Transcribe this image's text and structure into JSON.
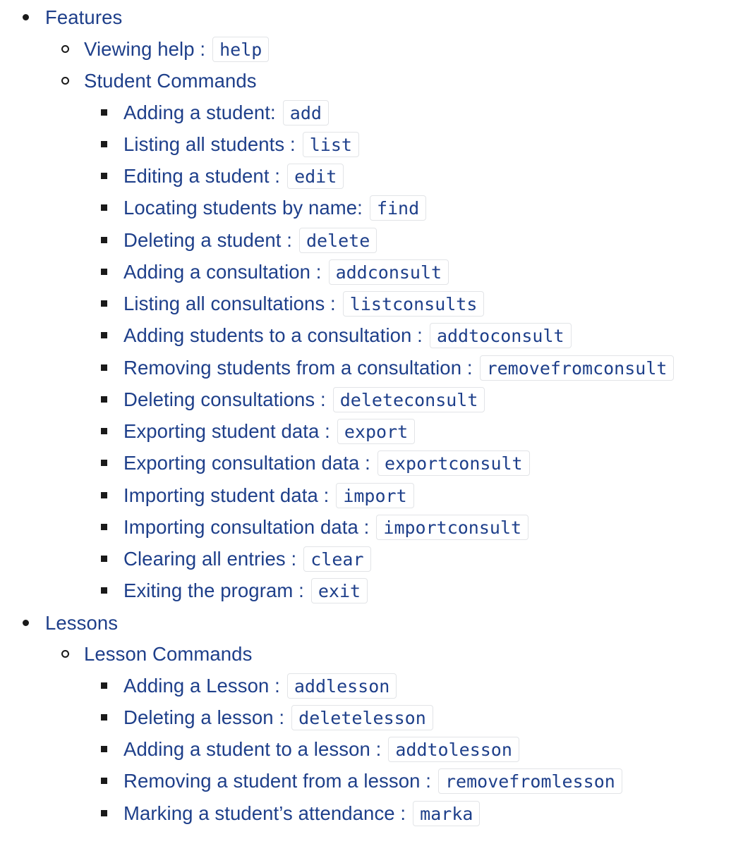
{
  "toc": {
    "features": {
      "label": "Features",
      "viewing_help": {
        "label": "Viewing help :",
        "code": "help"
      },
      "student_commands": {
        "label": "Student Commands",
        "items": [
          {
            "label": "Adding a student:",
            "code": "add"
          },
          {
            "label": "Listing all students :",
            "code": "list"
          },
          {
            "label": "Editing a student :",
            "code": "edit"
          },
          {
            "label": "Locating students by name:",
            "code": "find"
          },
          {
            "label": "Deleting a student :",
            "code": "delete"
          },
          {
            "label": "Adding a consultation :",
            "code": "addconsult"
          },
          {
            "label": "Listing all consultations :",
            "code": "listconsults"
          },
          {
            "label": "Adding students to a consultation :",
            "code": "addtoconsult"
          },
          {
            "label": "Removing students from a consultation :",
            "code": "removefromconsult"
          },
          {
            "label": "Deleting consultations :",
            "code": "deleteconsult"
          },
          {
            "label": "Exporting student data :",
            "code": "export"
          },
          {
            "label": "Exporting consultation data :",
            "code": "exportconsult"
          },
          {
            "label": "Importing student data :",
            "code": "import"
          },
          {
            "label": "Importing consultation data :",
            "code": "importconsult"
          },
          {
            "label": "Clearing all entries :",
            "code": "clear"
          },
          {
            "label": "Exiting the program :",
            "code": "exit"
          }
        ]
      }
    },
    "lessons": {
      "label": "Lessons",
      "lesson_commands": {
        "label": "Lesson Commands",
        "items": [
          {
            "label": "Adding a Lesson :",
            "code": "addlesson"
          },
          {
            "label": "Deleting a lesson :",
            "code": "deletelesson"
          },
          {
            "label": "Adding a student to a lesson :",
            "code": "addtolesson"
          },
          {
            "label": "Removing a student from a lesson :",
            "code": "removefromlesson"
          },
          {
            "label": "Marking a student’s attendance :",
            "code": "marka"
          }
        ]
      }
    }
  }
}
